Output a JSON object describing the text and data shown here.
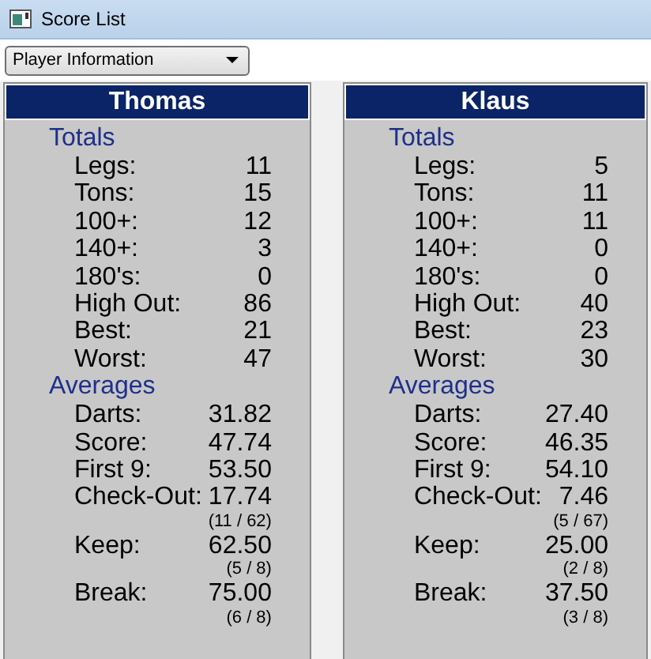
{
  "window": {
    "title": "Score List"
  },
  "view_select": {
    "value": "Player Information"
  },
  "players": [
    {
      "name": "Thomas",
      "sections": [
        {
          "title": "Totals",
          "rows": [
            {
              "label": "Legs:",
              "value": "11"
            },
            {
              "label": "Tons:",
              "value": "15"
            },
            {
              "label": "100+:",
              "value": "12"
            },
            {
              "label": "140+:",
              "value": "3"
            },
            {
              "label": "180's:",
              "value": "0"
            },
            {
              "label": "High Out:",
              "value": "86"
            },
            {
              "label": "Best:",
              "value": "21"
            },
            {
              "label": "Worst:",
              "value": "47"
            }
          ]
        },
        {
          "title": "Averages",
          "rows": [
            {
              "label": "Darts:",
              "value": "31.82"
            },
            {
              "label": "Score:",
              "value": "47.74"
            },
            {
              "label": "First 9:",
              "value": "53.50"
            },
            {
              "label": "Check-Out:",
              "value": "17.74",
              "detail": "(11 / 62)"
            },
            {
              "label": "Keep:",
              "value": "62.50",
              "detail": "(5 / 8)"
            },
            {
              "label": "Break:",
              "value": "75.00",
              "detail": "(6 / 8)"
            }
          ]
        }
      ]
    },
    {
      "name": "Klaus",
      "sections": [
        {
          "title": "Totals",
          "rows": [
            {
              "label": "Legs:",
              "value": "5"
            },
            {
              "label": "Tons:",
              "value": "11"
            },
            {
              "label": "100+:",
              "value": "11"
            },
            {
              "label": "140+:",
              "value": "0"
            },
            {
              "label": "180's:",
              "value": "0"
            },
            {
              "label": "High Out:",
              "value": "40"
            },
            {
              "label": "Best:",
              "value": "23"
            },
            {
              "label": "Worst:",
              "value": "30"
            }
          ]
        },
        {
          "title": "Averages",
          "rows": [
            {
              "label": "Darts:",
              "value": "27.40"
            },
            {
              "label": "Score:",
              "value": "46.35"
            },
            {
              "label": "First 9:",
              "value": "54.10"
            },
            {
              "label": "Check-Out:",
              "value": "7.46",
              "detail": "(5 / 67)"
            },
            {
              "label": "Keep:",
              "value": "25.00",
              "detail": "(2 / 8)"
            },
            {
              "label": "Break:",
              "value": "37.50",
              "detail": "(3 / 8)"
            }
          ]
        }
      ]
    }
  ]
}
